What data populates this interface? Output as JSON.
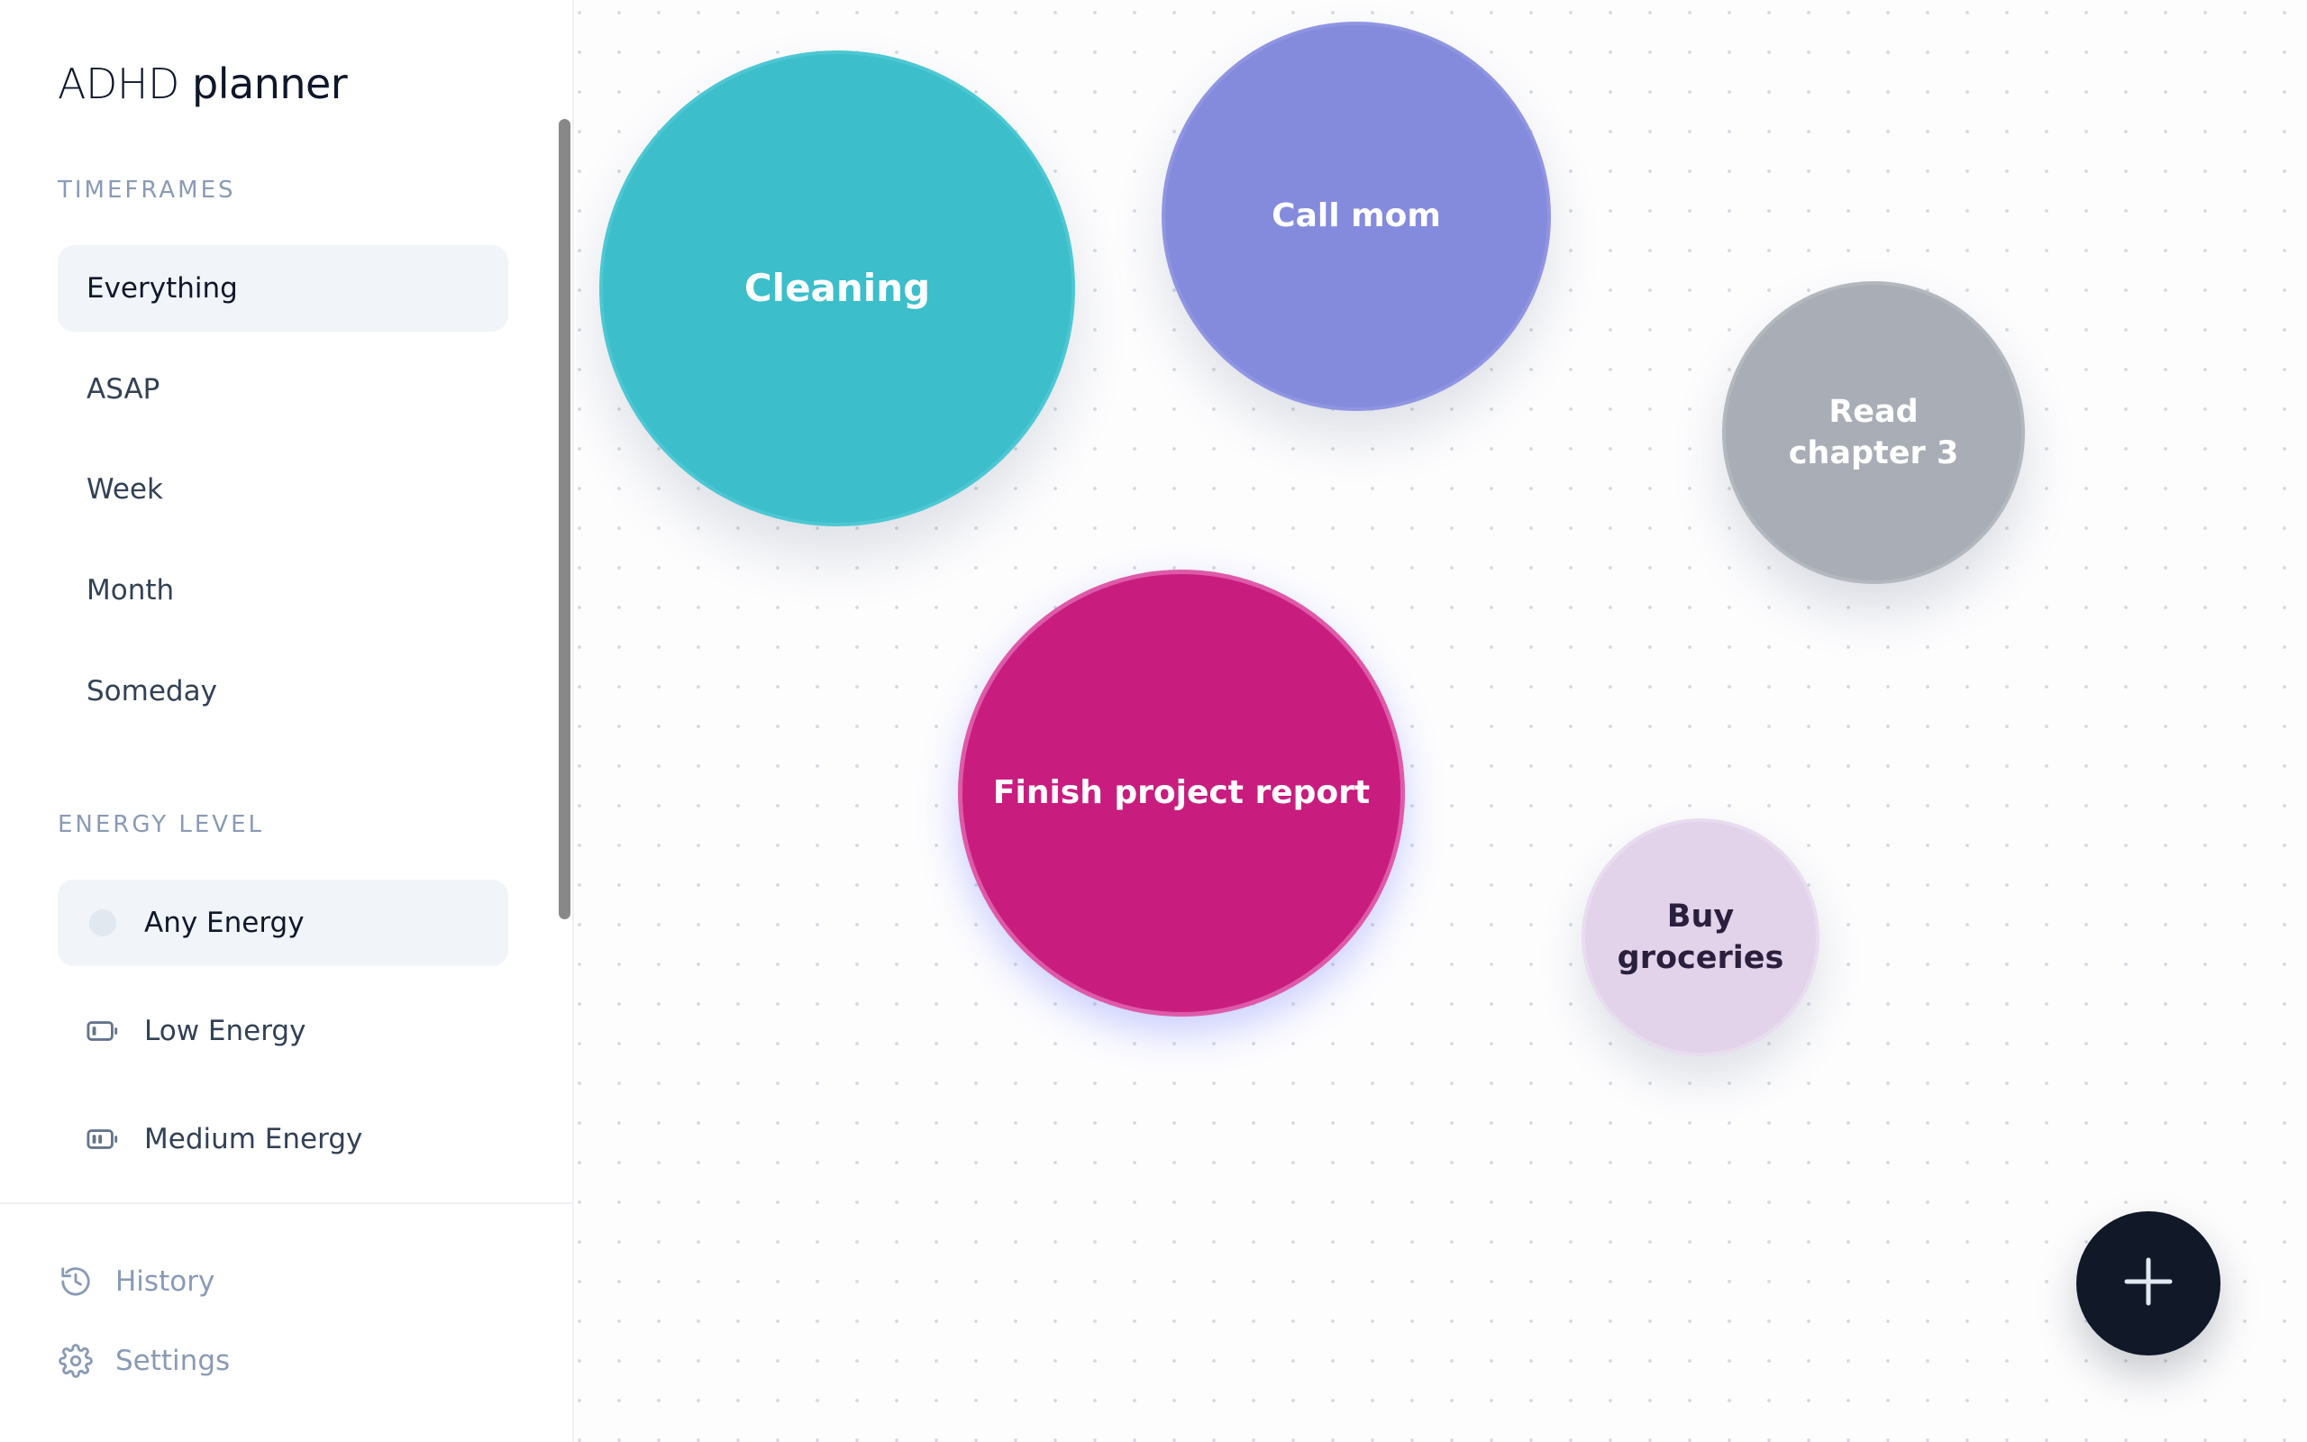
{
  "app": {
    "title_light": "ADHD",
    "title_bold": "planner"
  },
  "sidebar": {
    "timeframes_label": "TIMEFRAMES",
    "timeframes": [
      {
        "label": "Everything",
        "selected": true
      },
      {
        "label": "ASAP",
        "selected": false
      },
      {
        "label": "Week",
        "selected": false
      },
      {
        "label": "Month",
        "selected": false
      },
      {
        "label": "Someday",
        "selected": false
      }
    ],
    "energy_label": "ENERGY LEVEL",
    "energy_levels": [
      {
        "label": "Any Energy",
        "icon": "dot-icon",
        "selected": true
      },
      {
        "label": "Low Energy",
        "icon": "battery-low-icon",
        "selected": false
      },
      {
        "label": "Medium Energy",
        "icon": "battery-medium-icon",
        "selected": false
      }
    ],
    "footer": [
      {
        "label": "History",
        "icon": "history-icon"
      },
      {
        "label": "Settings",
        "icon": "settings-icon"
      }
    ]
  },
  "canvas": {
    "tasks": [
      {
        "label": "Cleaning",
        "color": "#3cbecb"
      },
      {
        "label": "Call mom",
        "color": "#858bdc"
      },
      {
        "label": "Read chapter 3",
        "color": "#a9adb5"
      },
      {
        "label": "Finish project report",
        "color": "#c81d7f"
      },
      {
        "label": "Buy groceries",
        "color": "#e2d3ea"
      }
    ],
    "add_button_icon": "plus-icon"
  },
  "colors": {
    "selected_bg": "#f1f4f9",
    "muted_text": "#8a9ab5",
    "fab_bg": "#111827"
  }
}
